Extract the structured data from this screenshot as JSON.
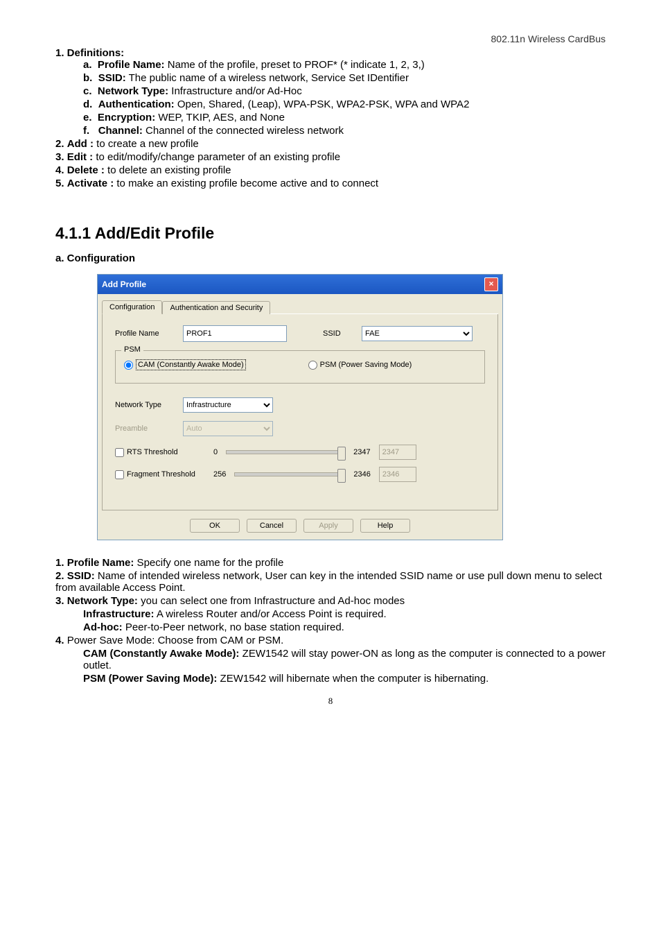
{
  "header": {
    "right": "802.11n Wireless CardBus"
  },
  "defs": {
    "title": "1. Definitions:",
    "items": [
      {
        "letter": "a.",
        "term": "Profile Name:",
        "desc": " Name of the profile, preset to PROF* (* indicate 1, 2, 3,)"
      },
      {
        "letter": "b.",
        "term": "SSID:",
        "desc": " The public name of a wireless network, Service Set IDentifier"
      },
      {
        "letter": "c.",
        "term": "Network Type:",
        "desc": " Infrastructure and/or Ad-Hoc"
      },
      {
        "letter": "d.",
        "term": "Authentication:",
        "desc": " Open, Shared, (Leap), WPA-PSK, WPA2-PSK, WPA and WPA2"
      },
      {
        "letter": "e.",
        "term": "Encryption:",
        "desc": " WEP, TKIP, AES, and None"
      },
      {
        "letter": "f.",
        "term": "Channel:",
        "desc": " Channel of the connected wireless network"
      }
    ]
  },
  "ops": [
    {
      "num": "2.",
      "term": "Add :",
      "desc": " to create a new profile"
    },
    {
      "num": "3.",
      "term": "Edit :",
      "desc": " to edit/modify/change parameter of an existing profile"
    },
    {
      "num": "4.",
      "term": "Delete :",
      "desc": " to delete an existing profile"
    },
    {
      "num": "5.",
      "term": "Activate :",
      "desc": " to make an existing profile become active and to connect"
    }
  ],
  "section": {
    "title": "4.1.1 Add/Edit Profile",
    "sub": "a. Configuration"
  },
  "dialog": {
    "title": "Add Profile",
    "tabs": {
      "t1": "Configuration",
      "t2": "Authentication and Security"
    },
    "profileNameLabel": "Profile Name",
    "profileNameValue": "PROF1",
    "ssidLabel": "SSID",
    "ssidValue": "FAE",
    "psm": {
      "legend": "PSM",
      "cam": "CAM (Constantly Awake Mode)",
      "psm": "PSM (Power Saving Mode)"
    },
    "networkTypeLabel": "Network Type",
    "networkTypeValue": "Infrastructure",
    "preambleLabel": "Preamble",
    "preambleValue": "Auto",
    "rtsLabel": "RTS Threshold",
    "rtsMin": "0",
    "rtsMax": "2347",
    "rtsVal": "2347",
    "fragLabel": "Fragment Threshold",
    "fragMin": "256",
    "fragMax": "2346",
    "fragVal": "2346",
    "buttons": {
      "ok": "OK",
      "cancel": "Cancel",
      "apply": "Apply",
      "help": "Help"
    }
  },
  "body": {
    "i1_num": "1.",
    "i1_term": "Profile Name:",
    "i1_desc": " Specify one name for the profile",
    "i2_num": "2.",
    "i2_term": "SSID:",
    "i2_desc": " Name of intended wireless network, User can key in the intended SSID name or use pull down menu to select from available Access Point.",
    "i3_num": "3.",
    "i3_term": "Network Type:",
    "i3_desc": " you can select one from Infrastructure and Ad-hoc modes",
    "i3a_term": "Infrastructure:",
    "i3a_desc": " A wireless Router and/or Access Point is required.",
    "i3b_term": "Ad-hoc:",
    "i3b_desc": " Peer-to-Peer network, no base station required.",
    "i4_num": "4.",
    "i4_desc_a": "Power Save Mode: Choose from CAM or PSM.",
    "i4a_term": "CAM (Constantly Awake Mode):",
    "i4a_desc": " ZEW1542 will stay power-ON as long as the computer is connected to a power outlet.",
    "i4b_term": "PSM (Power Saving Mode):",
    "i4b_desc": " ZEW1542 will hibernate when the computer is hibernating."
  },
  "footer": {
    "page": "8"
  }
}
